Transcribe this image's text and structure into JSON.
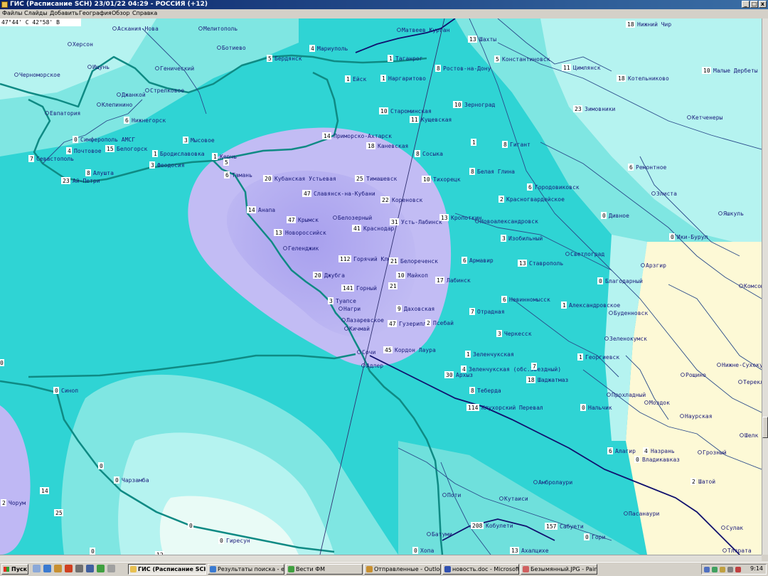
{
  "window": {
    "title": "ГИС (Расписание SCH) 23/01/22 04:29 - РОССИЯ (+12)",
    "controls": {
      "minimize": "_",
      "maximize": "□",
      "close": "x"
    }
  },
  "menu": [
    "Файлы",
    "Слайды",
    "Добавить",
    "География",
    "Обзор",
    "Справка"
  ],
  "coord_readout": "47°44' С 42°58' В",
  "colors": {
    "zone_high": "#b0a8f0",
    "zone_mid": "#bfb8f4",
    "zone_cyan_dark": "#18d2d6",
    "zone_cyan_light": "#b5f3f0",
    "zone_dry": "#fdf9d6",
    "coastline": "#0f8a84",
    "border": "#10106e",
    "roads": "#2a4a8a",
    "labels": "#1a1a7a"
  },
  "places": [
    {
      "name": "Аскания-Нова",
      "value": ""
    },
    {
      "name": "Мелитополь",
      "value": ""
    },
    {
      "name": "Херсон",
      "value": ""
    },
    {
      "name": "Матвеев Курган",
      "value": ""
    },
    {
      "name": "Шахты",
      "value": "13"
    },
    {
      "name": "Нижний Чир",
      "value": "18"
    },
    {
      "name": "Ботиево",
      "value": ""
    },
    {
      "name": "Мариуполь",
      "value": "4"
    },
    {
      "name": "Бердянск",
      "value": "5"
    },
    {
      "name": "Таганрог",
      "value": "1"
    },
    {
      "name": "Константиновск",
      "value": "5"
    },
    {
      "name": "Ищунь",
      "value": ""
    },
    {
      "name": "Генический",
      "value": ""
    },
    {
      "name": "Ростов-на-Дону",
      "value": "8"
    },
    {
      "name": "Цимлянск",
      "value": "11"
    },
    {
      "name": "Малые Дербеты",
      "value": "10"
    },
    {
      "name": "Черноморское",
      "value": ""
    },
    {
      "name": "Ейск",
      "value": "1"
    },
    {
      "name": "Наргаритово",
      "value": "1"
    },
    {
      "name": "Котельниково",
      "value": "18"
    },
    {
      "name": "Стрелковое",
      "value": ""
    },
    {
      "name": "Джанкой",
      "value": ""
    },
    {
      "name": "Клепинино",
      "value": ""
    },
    {
      "name": "Староминская",
      "value": "10"
    },
    {
      "name": "Зерноград",
      "value": "10"
    },
    {
      "name": "Зимовники",
      "value": "23"
    },
    {
      "name": "Евпатория",
      "value": ""
    },
    {
      "name": "Нижнегорск",
      "value": "6"
    },
    {
      "name": "Кущевская",
      "value": "11"
    },
    {
      "name": "Кетченеры",
      "value": ""
    },
    {
      "name": "Симферополь АМСГ",
      "value": "0"
    },
    {
      "name": "Мысовое",
      "value": "3"
    },
    {
      "name": "Приморско-Ахтарск",
      "value": "14"
    },
    {
      "name": "Почтовое",
      "value": "4"
    },
    {
      "name": "Белогорск",
      "value": "15"
    },
    {
      "name": "Бродиславовка",
      "value": "1"
    },
    {
      "name": "Керчь",
      "value": "1"
    },
    {
      "name": "Каневская",
      "value": "18"
    },
    {
      "name": "Гигант",
      "value": "8"
    },
    {
      "name": "Севастополь",
      "value": "7"
    },
    {
      "name": "Феодосия",
      "value": "3"
    },
    {
      "name": "Сосыка",
      "value": "8"
    },
    {
      "name": "Алушта",
      "value": "8"
    },
    {
      "name": "Ай-Петри",
      "value": "23"
    },
    {
      "name": "Тамань",
      "value": "6"
    },
    {
      "name": "Кубанская Устьевая",
      "value": "20"
    },
    {
      "name": "Тимашевск",
      "value": "25"
    },
    {
      "name": "Тихорецк",
      "value": "10"
    },
    {
      "name": "Белая Глина",
      "value": "8"
    },
    {
      "name": "Ремонтное",
      "value": "6"
    },
    {
      "name": "Славянск-на-Кубани",
      "value": "47"
    },
    {
      "name": "Городовиковск",
      "value": "6"
    },
    {
      "name": "Кореновск",
      "value": "22"
    },
    {
      "name": "Элиста",
      "value": ""
    },
    {
      "name": "Красногвардейское",
      "value": "2"
    },
    {
      "name": "Анапа",
      "value": "14"
    },
    {
      "name": "Крымск",
      "value": "47"
    },
    {
      "name": "Белозерный",
      "value": ""
    },
    {
      "name": "Кропоткин",
      "value": "13"
    },
    {
      "name": "Яшкуль",
      "value": ""
    },
    {
      "name": "Усть-Лабинск",
      "value": "31"
    },
    {
      "name": "Новоалександровск",
      "value": ""
    },
    {
      "name": "Дивное",
      "value": "0"
    },
    {
      "name": "Краснодар",
      "value": "41"
    },
    {
      "name": "Новороссийск",
      "value": "13"
    },
    {
      "name": "Изобильный",
      "value": "3"
    },
    {
      "name": "Ики-Бурул",
      "value": "0"
    },
    {
      "name": "Геленджик",
      "value": ""
    },
    {
      "name": "Светлоград",
      "value": ""
    },
    {
      "name": "Горячий Ключ",
      "value": "112"
    },
    {
      "name": "Белореченск",
      "value": "21"
    },
    {
      "name": "Армавир",
      "value": "6"
    },
    {
      "name": "Ставрополь",
      "value": "13"
    },
    {
      "name": "Арзгир",
      "value": ""
    },
    {
      "name": "Майкоп",
      "value": "10"
    },
    {
      "name": "Джубга",
      "value": "20"
    },
    {
      "name": "Лабинск",
      "value": "17"
    },
    {
      "name": "Благодарный",
      "value": "0"
    },
    {
      "name": "Горный",
      "value": "141"
    },
    {
      "name": "Невинномысск",
      "value": "6"
    },
    {
      "name": "Туапсе",
      "value": "3"
    },
    {
      "name": "Даховская",
      "value": "9"
    },
    {
      "name": "Александровское",
      "value": "1"
    },
    {
      "name": "Буденновск",
      "value": ""
    },
    {
      "name": "Нагри",
      "value": ""
    },
    {
      "name": "Отрадная",
      "value": "7"
    },
    {
      "name": "Лазаревское",
      "value": ""
    },
    {
      "name": "Гузерипль",
      "value": "47"
    },
    {
      "name": "Псебай",
      "value": "2"
    },
    {
      "name": "Кичмай",
      "value": ""
    },
    {
      "name": "Черкесск",
      "value": "3"
    },
    {
      "name": "Зеленокумск",
      "value": ""
    },
    {
      "name": "Кордон Лаура",
      "value": "45"
    },
    {
      "name": "Зеленчукская",
      "value": "1"
    },
    {
      "name": "Георгиевск",
      "value": "1"
    },
    {
      "name": "Сочи",
      "value": ""
    },
    {
      "name": "Адлер",
      "value": ""
    },
    {
      "name": "Зеленчукская (обс.Звездный)",
      "value": "4"
    },
    {
      "name": "Архыз",
      "value": "30"
    },
    {
      "name": "Шаджатмаз",
      "value": "18"
    },
    {
      "name": "Рощино",
      "value": ""
    },
    {
      "name": "Терекли-Мекте",
      "value": ""
    },
    {
      "name": "Теберда",
      "value": "8"
    },
    {
      "name": "Прохладный",
      "value": ""
    },
    {
      "name": "Моздок",
      "value": ""
    },
    {
      "name": "Синоп",
      "value": "0"
    },
    {
      "name": "Клухорский Перевал",
      "value": "114"
    },
    {
      "name": "Нальчик",
      "value": "0"
    },
    {
      "name": "Наурская",
      "value": ""
    },
    {
      "name": "Нижне-Сухокумск",
      "value": ""
    },
    {
      "name": "Алагир",
      "value": "6"
    },
    {
      "name": "Назрань",
      "value": "4"
    },
    {
      "name": "Грозный",
      "value": ""
    },
    {
      "name": "Владикавказ",
      "value": "0"
    },
    {
      "name": "Чарзамба",
      "value": "0"
    },
    {
      "name": "Шатой",
      "value": "2"
    },
    {
      "name": "Амбролаури",
      "value": ""
    },
    {
      "name": "Поти",
      "value": ""
    },
    {
      "name": "Кутаиси",
      "value": ""
    },
    {
      "name": "Чорум",
      "value": "2"
    },
    {
      "name": "Пасанаури",
      "value": ""
    },
    {
      "name": "Кобулети",
      "value": "208"
    },
    {
      "name": "Сабуети",
      "value": "157"
    },
    {
      "name": "Гори",
      "value": "0"
    },
    {
      "name": "Батуми",
      "value": ""
    },
    {
      "name": "Сулак",
      "value": ""
    },
    {
      "name": "Гиресун",
      "value": "0"
    },
    {
      "name": "Хопа",
      "value": "0"
    },
    {
      "name": "Ахалцихе",
      "value": "13"
    },
    {
      "name": "Тляратa",
      "value": ""
    },
    {
      "name": "Комсомольский",
      "value": ""
    },
    {
      "name": "Шелк",
      "value": ""
    }
  ],
  "loose_values": [
    "14",
    "25",
    "0",
    "0",
    "0",
    "0",
    "5",
    "21",
    "12",
    "1",
    "7"
  ],
  "taskbar": {
    "start_label": "Пуск",
    "tasks": [
      {
        "label": "ГИС (Расписание SCH...",
        "active": true
      },
      {
        "label": "Результаты поиска - е...",
        "active": false
      },
      {
        "label": "Вести ФМ",
        "active": false
      },
      {
        "label": "Отправленные - Outloo...",
        "active": false
      },
      {
        "label": "новость.doc - Microsoft ...",
        "active": false
      },
      {
        "label": "Безымянный.JPG - Paint",
        "active": false
      }
    ],
    "clock": "9:14"
  }
}
